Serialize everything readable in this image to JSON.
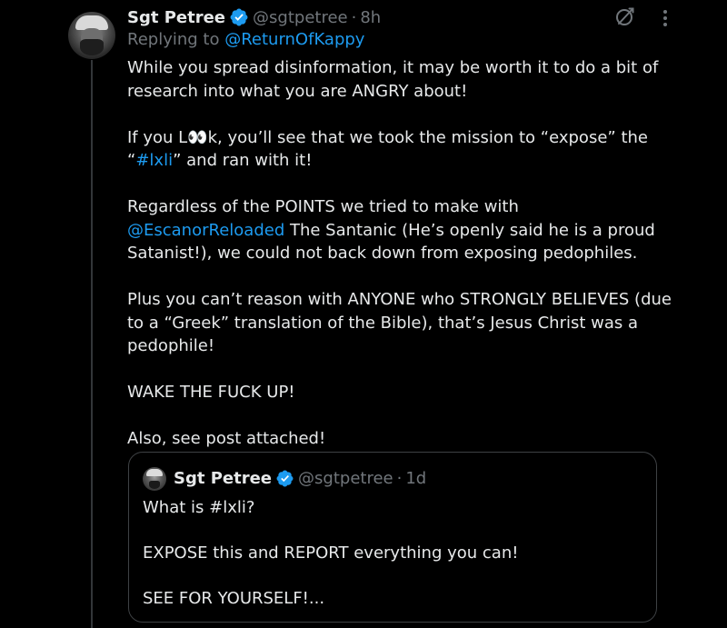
{
  "tweet": {
    "display_name": "Sgt Petree",
    "handle": "@sgtpetree",
    "separator": "·",
    "time": "8h",
    "replying_prefix": "Replying to ",
    "replying_to": "@ReturnOfKappy",
    "p1": "While you spread disinformation, it may be worth it to do a bit of research into what you are ANGRY about!",
    "p2_a": "If you L",
    "p2_eyes": "👀",
    "p2_b": "k, you’ll see that we took the mission to “expose” the “",
    "p2_tag": "#lxli",
    "p2_c": "” and ran with it!",
    "p3_a": "Regardless of the POINTS we tried to make with ",
    "p3_mention": "@EscanorReloaded",
    "p3_b": " The Santanic (He’s openly said he is a proud Satanist!), we could not back down from exposing pedophiles.",
    "p4": "Plus you can’t reason with ANYONE who STRONGLY BELIEVES (due to a “Greek” translation of the Bible), that’s Jesus Christ was a pedophile!",
    "p5": "WAKE THE FUCK UP!",
    "p6": "Also, see post attached!"
  },
  "quote": {
    "display_name": "Sgt Petree",
    "handle": "@sgtpetree",
    "separator": "·",
    "time": "1d",
    "line1": "What is #lxli?",
    "line2": "EXPOSE this and REPORT everything you can!",
    "line3": "SEE FOR YOURSELF!..."
  },
  "icons": {
    "verified": "verified-badge-icon",
    "grok": "grok-icon",
    "more": "more-options-icon"
  },
  "colors": {
    "background": "#000000",
    "text": "#e7e9ea",
    "muted": "#71767b",
    "link": "#1d9bf0",
    "border": "#3e4144"
  }
}
